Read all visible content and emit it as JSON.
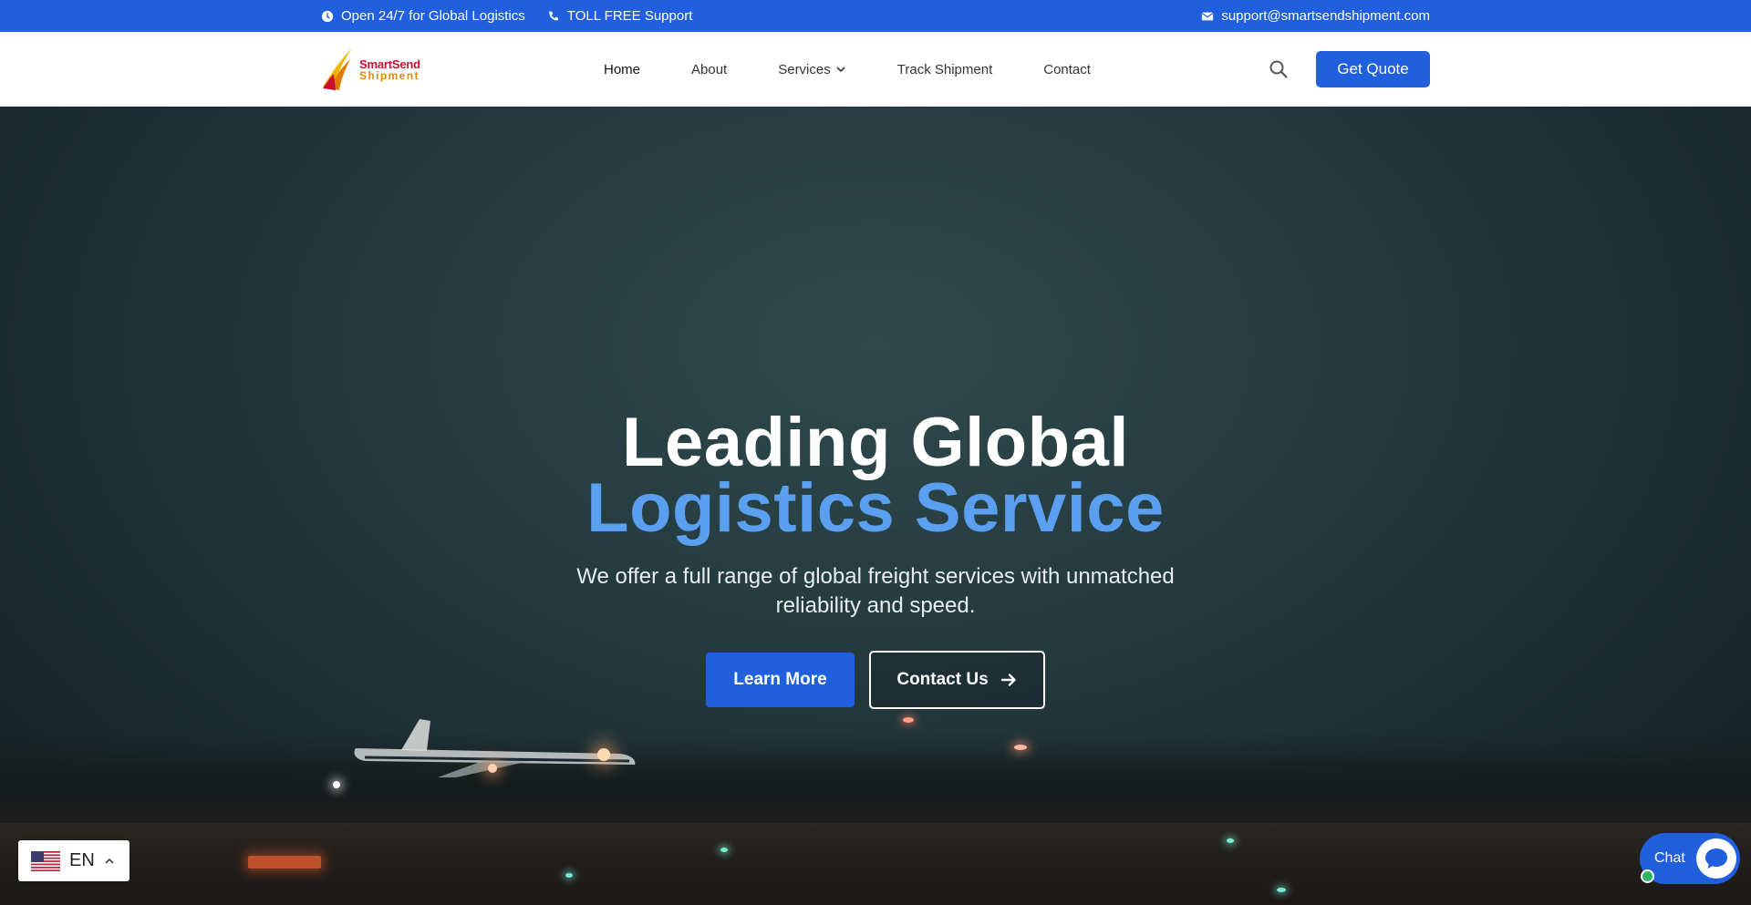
{
  "topbar": {
    "hours": "Open 24/7 for Global Logistics",
    "phone": "TOLL FREE Support",
    "email": "support@smartsendshipment.com"
  },
  "brand": {
    "line1": "SmartSend",
    "line2": "Shipment",
    "primary_color": "#2060de",
    "accent_color": "#5b9ff0"
  },
  "nav": {
    "items": [
      {
        "label": "Home"
      },
      {
        "label": "About"
      },
      {
        "label": "Services"
      },
      {
        "label": "Track Shipment"
      },
      {
        "label": "Contact"
      }
    ],
    "cta": "Get Quote"
  },
  "hero": {
    "title_line1": "Leading Global",
    "title_line2": "Logistics Service",
    "subtitle": "We offer a full range of global freight services with unmatched reliability and speed.",
    "primary_button": "Learn More",
    "secondary_button": "Contact Us"
  },
  "language": {
    "code": "EN"
  },
  "chat": {
    "label": "Chat"
  }
}
